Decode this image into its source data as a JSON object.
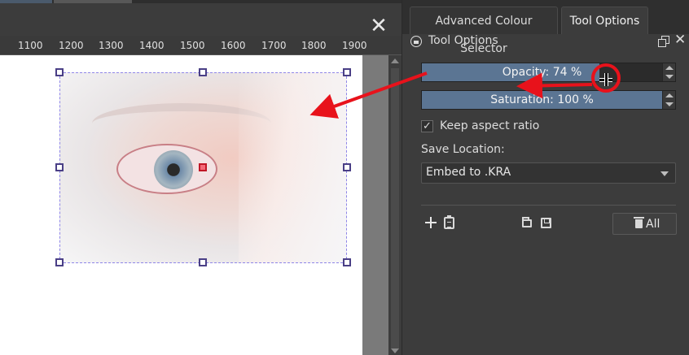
{
  "canvas": {
    "close_glyph": "✕",
    "ruler_labels": [
      "1100",
      "1200",
      "1300",
      "1400",
      "1500",
      "1600",
      "1700",
      "1800",
      "1900"
    ]
  },
  "docker": {
    "tabs": [
      {
        "label": "Advanced Colour Selector",
        "active": false
      },
      {
        "label": "Tool Options",
        "active": true
      }
    ],
    "title": "Tool Options",
    "close_glyph": "✕"
  },
  "tool_options": {
    "opacity": {
      "label": "Opacity: 74 %",
      "value_percent": 74
    },
    "saturation": {
      "label": "Saturation: 100 %",
      "value_percent": 100
    },
    "keep_aspect_ratio": {
      "label": "Keep aspect ratio",
      "checked": true,
      "check_glyph": "✓"
    },
    "save_location": {
      "label": "Save Location:",
      "value": "Embed to .KRA"
    },
    "actions": {
      "add_icon": "plus-icon",
      "clipboard_icon": "clipboard-icon",
      "open_icon": "folder-icon",
      "save_icon": "save-icon",
      "all_button": {
        "icon": "trash-icon",
        "label": "All"
      }
    }
  },
  "annotation": {
    "color": "#e8121b"
  }
}
